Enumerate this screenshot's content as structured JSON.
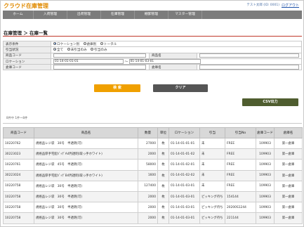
{
  "app": {
    "logo": "クラウド在庫管理",
    "user": "テスト太郎 (ID: 0001)",
    "logout": "ログアウト"
  },
  "nav": [
    "ホーム",
    "入荷管理",
    "出荷管理",
    "在庫管理",
    "棚卸管理",
    "マスター管理"
  ],
  "page_title": "在庫管理 ＞ 在庫一覧",
  "form": {
    "display_label": "表示条件",
    "display_options": [
      "ロケーション別",
      "倉庫別",
      "トータル"
    ],
    "reserve_label": "引当状況",
    "reserve_options": [
      "全て",
      "未引当のみ",
      "引当のみ"
    ],
    "product_code_label": "商品コード",
    "product_name_label": "商品名",
    "location_label": "ロケーション",
    "location_from": "01-14-01-01-01",
    "range_sep": "～",
    "location_to": "01-14-01-03-01",
    "warehouse_code_label": "倉庫コード",
    "warehouse_name_label": "倉庫名"
  },
  "buttons": {
    "search": "検 索",
    "clear": "クリア",
    "csv": "CSV出力"
  },
  "count_text": "8件中 1件～8件",
  "table": {
    "headers": [
      "商品コード",
      "商品名",
      "数量",
      "単位",
      "ロケーション",
      "引当",
      "引当No",
      "倉庫コード",
      "倉庫名"
    ],
    "rows": [
      [
        "10220762",
        "規格品レジ袋　30号　半透明(可)",
        "27000",
        "枚",
        "01-14-01-01-01",
        "未",
        "FREE",
        "109903",
        "第一倉庫"
      ],
      [
        "30223023",
        "規格品厚手宅配ﾊﾞｯｸﾞA4判透明(取っ手ホワイト)",
        "2000",
        "枚",
        "01-14-01-01-02",
        "未",
        "FREE",
        "109903",
        "第一倉庫"
      ],
      [
        "10220761",
        "規格品レジ袋　45号　半透明(可)",
        "58000",
        "枚",
        "01-14-01-02-01",
        "未",
        "FREE",
        "109903",
        "第一倉庫"
      ],
      [
        "30223024",
        "規格品厚手宅配ﾊﾞｯｸﾞB4判透明(取っ手ホワイト)",
        "1600",
        "枚",
        "01-14-01-02-02",
        "未",
        "FREE",
        "109903",
        "第一倉庫"
      ],
      [
        "10220758",
        "規格品レジ袋　30号　半透明(可)",
        "127400",
        "枚",
        "01-14-01-03-01",
        "未",
        "FREE",
        "109903",
        "第一倉庫"
      ],
      [
        "10220758",
        "規格品レジ袋　30号　半透明(可)",
        "2000",
        "枚",
        "01-14-01-03-01",
        "ピッキング待ち",
        "154144",
        "109903",
        "第一倉庫"
      ],
      [
        "10220758",
        "規格品レジ袋　30号　半透明(可)",
        "2000",
        "枚",
        "01-14-01-03-01",
        "ピッキング待ち",
        "20200S1244",
        "109903",
        "第一倉庫"
      ],
      [
        "10220758",
        "規格品レジ袋　30号　半透明(可)",
        "2000",
        "枚",
        "01-14-01-03-01",
        "ピッキング待ち",
        "221144",
        "109903",
        "第一倉庫"
      ]
    ]
  },
  "colors": {
    "brand": "#e08a00",
    "nav": "#7c7c7c",
    "search": "#f0a000",
    "clear": "#555555",
    "csv": "#4f5d2f",
    "accent_line": "#c0392b"
  }
}
